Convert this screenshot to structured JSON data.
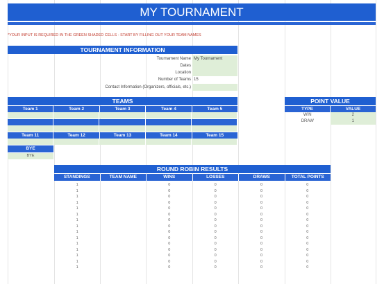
{
  "title": "MY TOURNAMENT",
  "note": "*YOUR INPUT IS REQUIRED IN THE GREEN SHADED CELLS - START BY FILLING OUT YOUR TEAM NAMES",
  "tournament_info": {
    "header": "TOURNAMENT INFORMATION",
    "rows": [
      {
        "label": "Tournament Name",
        "value": "My Tournament"
      },
      {
        "label": "Dates",
        "value": ""
      },
      {
        "label": "Location",
        "value": ""
      },
      {
        "label": "Number of Teams",
        "value": "15"
      },
      {
        "label": "Contact Information (Organizers, officials, etc.)",
        "value": ""
      }
    ]
  },
  "teams": {
    "header": "TEAMS",
    "row1": [
      "Team 1",
      "Team 2",
      "Team 3",
      "Team 4",
      "Team 5"
    ],
    "row3": [
      "Team 11",
      "Team 12",
      "Team 13",
      "Team 14",
      "Team 15"
    ],
    "bye_label": "BYE",
    "bye_value": "BYE"
  },
  "point_value": {
    "header": "POINT VALUE",
    "col_type": "TYPE",
    "col_value": "VALUE",
    "rows": [
      {
        "type": "WIN",
        "value": "2"
      },
      {
        "type": "DRAW",
        "value": "1"
      }
    ]
  },
  "round_robin": {
    "header": "ROUND ROBIN RESULTS",
    "columns": [
      "STANDINGS",
      "TEAM NAME",
      "WINS",
      "LOSSES",
      "DRAWS",
      "TOTAL POINTS"
    ],
    "rows": [
      [
        "1",
        "",
        "0",
        "0",
        "0",
        "0"
      ],
      [
        "1",
        "",
        "0",
        "0",
        "0",
        "0"
      ],
      [
        "1",
        "",
        "0",
        "0",
        "0",
        "0"
      ],
      [
        "1",
        "",
        "0",
        "0",
        "0",
        "0"
      ],
      [
        "1",
        "",
        "0",
        "0",
        "0",
        "0"
      ],
      [
        "1",
        "",
        "0",
        "0",
        "0",
        "0"
      ],
      [
        "1",
        "",
        "0",
        "0",
        "0",
        "0"
      ],
      [
        "1",
        "",
        "0",
        "0",
        "0",
        "0"
      ],
      [
        "1",
        "",
        "0",
        "0",
        "0",
        "0"
      ],
      [
        "1",
        "",
        "0",
        "0",
        "0",
        "0"
      ],
      [
        "1",
        "",
        "0",
        "0",
        "0",
        "0"
      ],
      [
        "1",
        "",
        "0",
        "0",
        "0",
        "0"
      ],
      [
        "1",
        "",
        "0",
        "0",
        "0",
        "0"
      ],
      [
        "1",
        "",
        "0",
        "0",
        "0",
        "0"
      ],
      [
        "1",
        "",
        "0",
        "0",
        "0",
        "0"
      ]
    ]
  },
  "colors": {
    "header_blue": "#1f5fd1",
    "input_green": "#dfeed8",
    "note_red": "#c0392b"
  }
}
